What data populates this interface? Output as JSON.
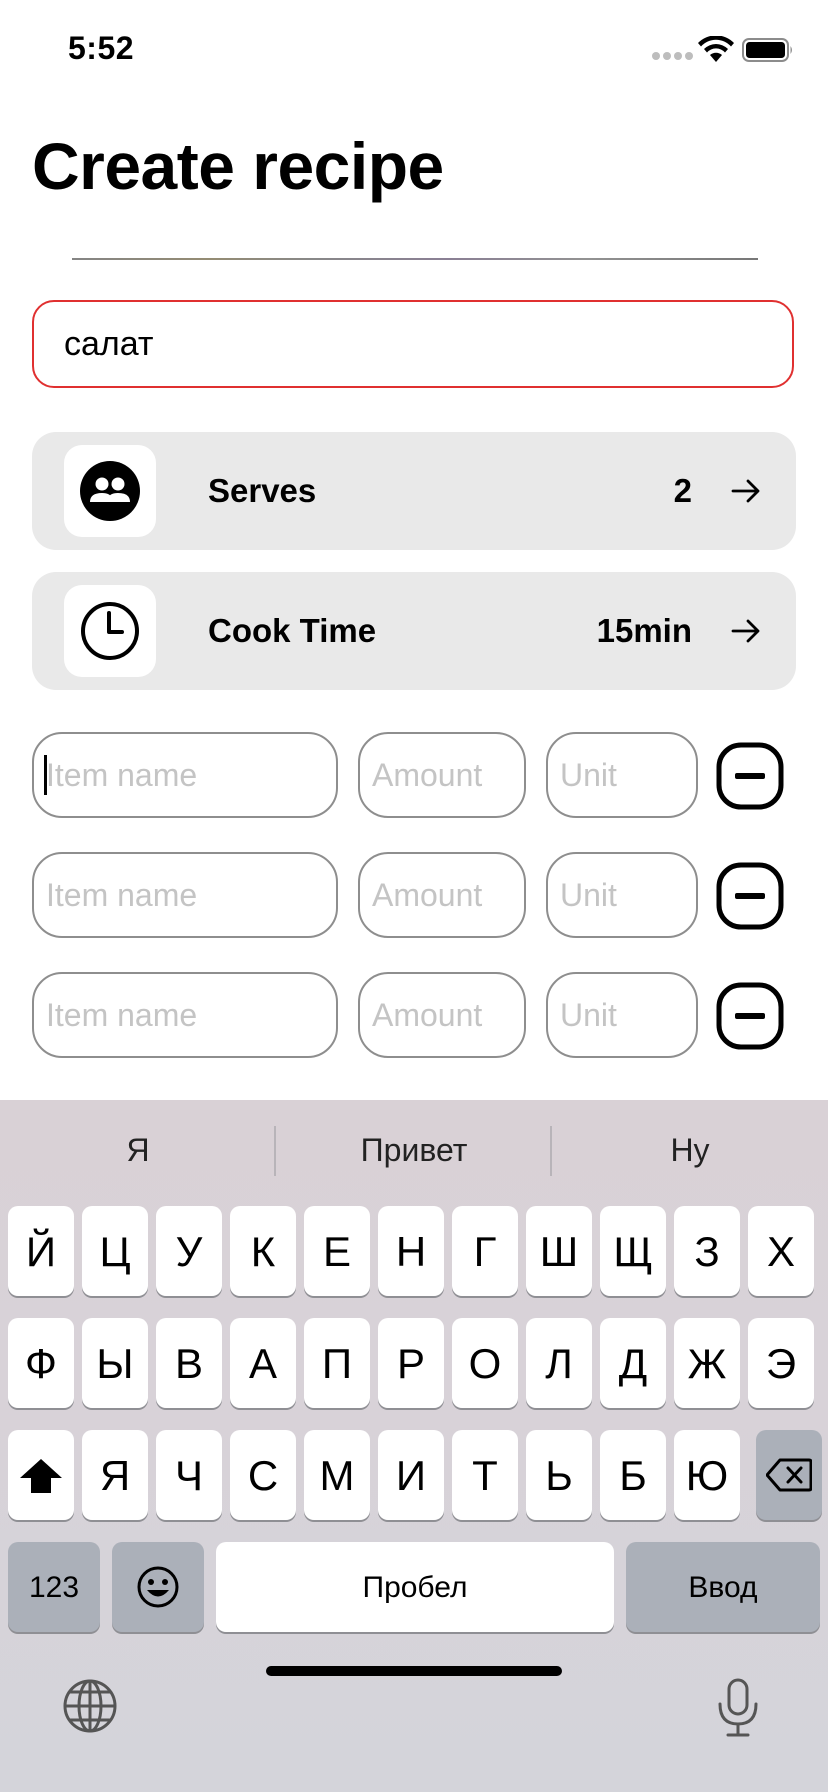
{
  "status_bar": {
    "time": "5:52"
  },
  "header": {
    "title": "Create recipe"
  },
  "recipe": {
    "name_value": "салат"
  },
  "settings": {
    "serves": {
      "label": "Serves",
      "value": "2"
    },
    "cook_time": {
      "label": "Cook Time",
      "value": "15min"
    }
  },
  "ingredients": {
    "placeholders": {
      "name": "Item name",
      "amount": "Amount",
      "unit": "Unit"
    },
    "rows": [
      {
        "name": "",
        "amount": "",
        "unit": ""
      },
      {
        "name": "",
        "amount": "",
        "unit": ""
      },
      {
        "name": "",
        "amount": "",
        "unit": ""
      }
    ]
  },
  "keyboard": {
    "suggestions": [
      "Я",
      "Привет",
      "Ну"
    ],
    "row1": [
      "Й",
      "Ц",
      "У",
      "К",
      "Е",
      "Н",
      "Г",
      "Ш",
      "Щ",
      "З",
      "Х"
    ],
    "row2": [
      "Ф",
      "Ы",
      "В",
      "А",
      "П",
      "Р",
      "О",
      "Л",
      "Д",
      "Ж",
      "Э"
    ],
    "row3": [
      "Я",
      "Ч",
      "С",
      "М",
      "И",
      "Т",
      "Ь",
      "Б",
      "Ю"
    ],
    "numbers_label": "123",
    "space_label": "Пробел",
    "return_label": "Ввод"
  },
  "icons": {
    "serves": "people-icon",
    "cook_time": "clock-icon",
    "arrow": "arrow-right-icon",
    "remove": "minus-square-icon",
    "shift": "shift-icon",
    "delete": "backspace-icon",
    "emoji": "emoji-icon",
    "globe": "globe-icon",
    "mic": "microphone-icon"
  },
  "colors": {
    "input_border": "#e03030",
    "row_background": "#e9e9e9",
    "keyboard_gray_key": "#abb0b9"
  }
}
